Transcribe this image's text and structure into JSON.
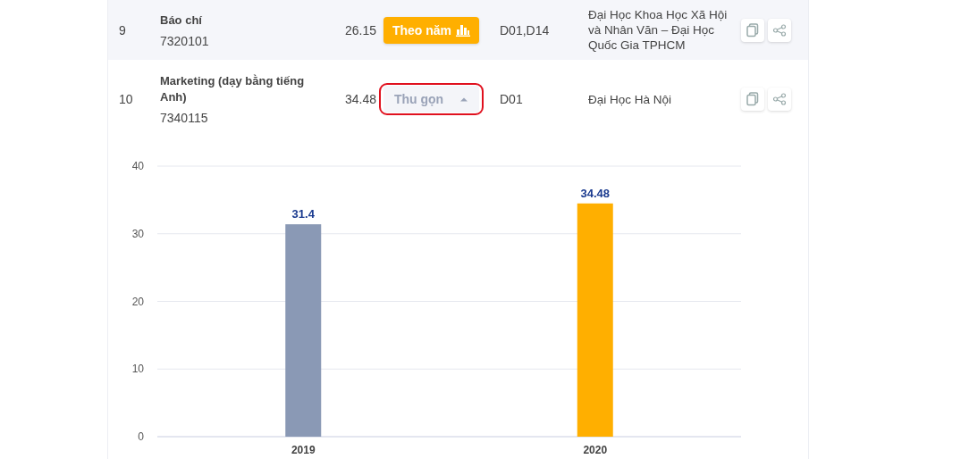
{
  "rows": [
    {
      "index": "9",
      "name": "Báo chí",
      "code": "7320101",
      "score": "26.15",
      "button": "Theo năm",
      "expanded": false,
      "highlighted": false,
      "combos": "D01,D14",
      "university": "Đại Học Khoa Học Xã Hội và Nhân Văn – Đại Học Quốc Gia TPHCM"
    },
    {
      "index": "10",
      "name": "Marketing (dạy bằng tiếng Anh)",
      "code": "7340115",
      "score": "34.48",
      "button": "Thu gọn",
      "expanded": true,
      "highlighted": true,
      "combos": "D01",
      "university": "Đại Học Hà Nội",
      "chart_data": {
        "type": "bar",
        "categories": [
          "2019",
          "2020"
        ],
        "series": [
          {
            "color": "#8a99b5",
            "values": [
              31.4,
              null
            ]
          },
          {
            "color": "#ffaf00",
            "values": [
              null,
              34.48
            ]
          }
        ],
        "grid": true,
        "ylim": [
          0,
          40
        ],
        "yticks": [
          0,
          10,
          20,
          30,
          40
        ],
        "data_labels": true
      }
    }
  ]
}
